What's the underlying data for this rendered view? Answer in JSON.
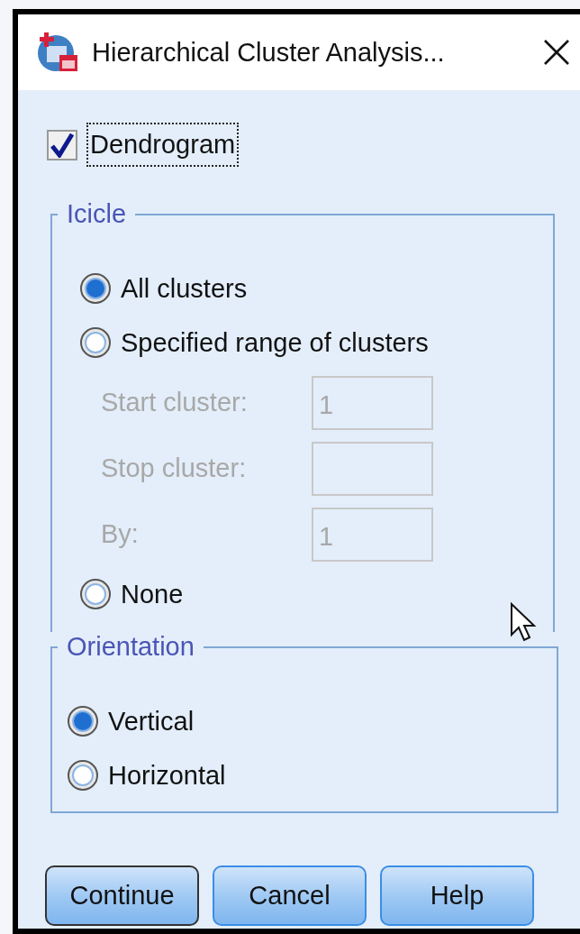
{
  "window": {
    "title": "Hierarchical Cluster Analysis..."
  },
  "dendrogram": {
    "label": "Dendrogram",
    "checked": true,
    "focused": true
  },
  "icicle": {
    "title": "Icicle",
    "items": [
      {
        "kind": "radio",
        "label": "All clusters",
        "selected": true
      },
      {
        "kind": "radio",
        "label": "Specified range of clusters",
        "selected": false
      },
      {
        "kind": "field",
        "label": "Start cluster:",
        "value": "1",
        "disabled": true
      },
      {
        "kind": "field",
        "label": "Stop cluster:",
        "disabled": true
      },
      {
        "kind": "field",
        "label": "By:",
        "value": "1",
        "disabled": true
      },
      {
        "kind": "radio",
        "label": "None",
        "selected": false
      }
    ]
  },
  "orientation": {
    "title": "Orientation",
    "items": [
      {
        "kind": "radio",
        "label": "Vertical",
        "selected": true
      },
      {
        "kind": "radio",
        "label": "Horizontal",
        "selected": false
      }
    ]
  },
  "buttons": [
    {
      "label": "Continue",
      "default": true
    },
    {
      "label": "Cancel",
      "default": false
    },
    {
      "label": "Help",
      "default": false
    }
  ]
}
